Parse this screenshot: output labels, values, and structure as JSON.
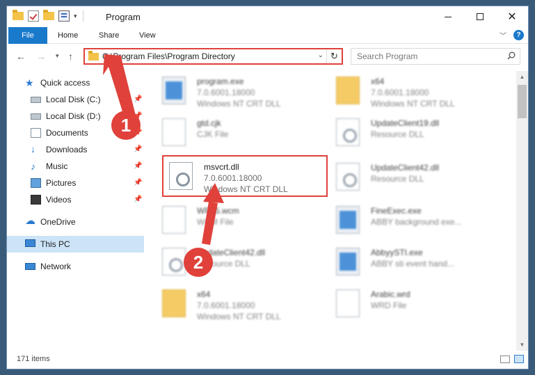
{
  "window": {
    "title": "Program",
    "controls": {
      "minimize": "",
      "maximize": "",
      "close": "✕"
    }
  },
  "ribbon": {
    "tabs": [
      "File",
      "Home",
      "Share",
      "View"
    ],
    "help": "?"
  },
  "address": {
    "path": "C:\\Program Files\\Program Directory",
    "search_placeholder": "Search Program"
  },
  "navigation": {
    "items": [
      {
        "label": "Quick access",
        "icon": "star-icon",
        "pinned": false
      },
      {
        "label": "Local Disk (C:)",
        "icon": "drive-icon",
        "pinned": true
      },
      {
        "label": "Local Disk (D:)",
        "icon": "drive-icon",
        "pinned": true
      },
      {
        "label": "Documents",
        "icon": "documents-icon",
        "pinned": true
      },
      {
        "label": "Downloads",
        "icon": "downloads-icon",
        "pinned": true
      },
      {
        "label": "Music",
        "icon": "music-icon",
        "pinned": true
      },
      {
        "label": "Pictures",
        "icon": "pictures-icon",
        "pinned": true
      },
      {
        "label": "Videos",
        "icon": "videos-icon",
        "pinned": true
      },
      {
        "label": "OneDrive",
        "icon": "onedrive-icon",
        "pinned": false
      },
      {
        "label": "This PC",
        "icon": "this-pc-icon",
        "pinned": false,
        "selected": true
      },
      {
        "label": "Network",
        "icon": "network-icon",
        "pinned": false
      }
    ]
  },
  "files": {
    "left": [
      {
        "name": "program.exe",
        "version": "7.0.6001.18000",
        "desc": "Windows NT CRT DLL",
        "icon": "app-icon"
      },
      {
        "name": "gtd.cjk",
        "version": "CJK File",
        "desc": "",
        "icon": "file-icon"
      },
      {
        "name": "msvcrt.dll",
        "version": "7.0.6001.18000",
        "desc": "Windows NT CRT DLL",
        "icon": "dll-gear-icon"
      },
      {
        "name": "WP15.wcm",
        "version": "WCM File",
        "desc": "",
        "icon": "file-icon"
      },
      {
        "name": "UpdateClient42.dll",
        "version": "Resource DLL",
        "desc": "",
        "icon": "dll-gear-icon"
      },
      {
        "name": "x64",
        "version": "7.0.6001.18000",
        "desc": "Windows NT CRT DLL",
        "icon": "folder-icon"
      }
    ],
    "right": [
      {
        "name": "x64",
        "version": "7.0.6001.18000",
        "desc": "Windows NT CRT DLL",
        "icon": "folder-icon"
      },
      {
        "name": "UpdateClient19.dll",
        "version": "Resource DLL",
        "desc": "",
        "icon": "dll-gear-icon"
      },
      {
        "name": "UpdateClient42.dll",
        "version": "Resource DLL",
        "desc": "",
        "icon": "dll-gear-icon"
      },
      {
        "name": "FineExec.exe",
        "version": "ABBY background exe...",
        "desc": "",
        "icon": "app-icon"
      },
      {
        "name": "AbbyySTI.exe",
        "version": "ABBY sti event hand...",
        "desc": "",
        "icon": "app-icon"
      },
      {
        "name": "Arabic.wrd",
        "version": "WRD File",
        "desc": "",
        "icon": "file-icon"
      }
    ]
  },
  "annotations": {
    "badge1": "1",
    "badge2": "2"
  },
  "status": {
    "item_count": "171 items"
  },
  "colors": {
    "accent": "#1979ca",
    "highlight": "#e0413b",
    "selected": "#cce4f7"
  }
}
